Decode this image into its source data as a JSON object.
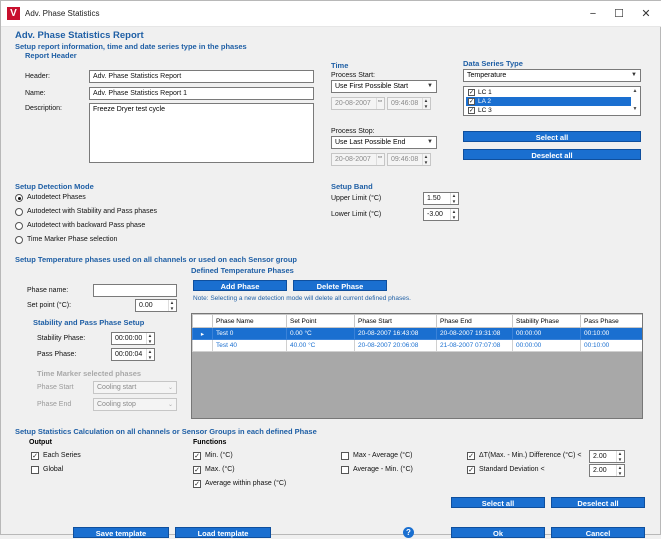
{
  "window": {
    "title": "Adv. Phase Statistics",
    "app_icon": "V",
    "min": "−",
    "max": "☐",
    "close": "✕"
  },
  "report": {
    "heading": "Adv. Phase Statistics Report",
    "subheading": "Setup report information, time and date series type in the phases",
    "section": "Report Header",
    "header_label": "Header:",
    "header_value": "Adv. Phase Statistics Report",
    "name_label": "Name:",
    "name_value": "Adv. Phase Statistics Report 1",
    "desc_label": "Description:",
    "desc_value": "Freeze Dryer test cycle"
  },
  "time": {
    "section": "Time",
    "start_label": "Process Start:",
    "start_option": "Use First Possible Start",
    "start_date": "20-08-2007",
    "start_time": "09:46:08",
    "stop_label": "Process Stop:",
    "stop_option": "Use Last Possible End",
    "stop_date": "20-08-2007",
    "stop_time": "09:46:08"
  },
  "data_series": {
    "section": "Data Series Type",
    "type": "Temperature",
    "items": [
      {
        "label": "LC 1",
        "checked": true,
        "selected": false
      },
      {
        "label": "LA 2",
        "checked": true,
        "selected": true
      },
      {
        "label": "LC 3",
        "checked": true,
        "selected": false
      }
    ],
    "select_all": "Select all",
    "deselect_all": "Deselect all"
  },
  "detection": {
    "section": "Setup Detection Mode",
    "options": [
      "Autodetect Phases",
      "Autodetect with Stability and Pass phases",
      "Autodetect with backward Pass phase",
      "Time Marker Phase selection"
    ],
    "selected": 0
  },
  "band": {
    "section": "Setup Band",
    "upper_label": "Upper Limit (°C)",
    "upper_value": "1.50",
    "lower_label": "Lower Limit (°C)",
    "lower_value": "-3.00"
  },
  "phases": {
    "section": "Setup Temperature phases used on all channels or used on each Sensor group",
    "defined_title": "Defined Temperature Phases",
    "name_label": "Phase name:",
    "name_value": "",
    "setpoint_label": "Set point (°C):",
    "setpoint_value": "0.00",
    "add": "Add Phase",
    "delete": "Delete Phase",
    "note": "Note: Selecting a new detection mode will delete all current defined phases.",
    "stab_section": "Stability and Pass Phase Setup",
    "stab_label": "Stability Phase:",
    "stab_value": "00:00:00",
    "pass_label": "Pass Phase:",
    "pass_value": "00:00:04",
    "marker_section": "Time Marker selected phases",
    "phase_start_label": "Phase Start",
    "phase_start_value": "Cooling start",
    "phase_end_label": "Phase End",
    "phase_end_value": "Cooling stop",
    "columns": [
      "Phase Name",
      "Set Point",
      "Phase Start",
      "Phase End",
      "Stability Phase",
      "Pass Phase"
    ],
    "rows": [
      {
        "marker": "▸",
        "cells": [
          "Test 0",
          "0.00 °C",
          "20-08-2007 16:43:08",
          "20-08-2007 19:31:08",
          "00:00:00",
          "00:10:00"
        ]
      },
      {
        "marker": "",
        "cells": [
          "Test 40",
          "40.00 °C",
          "20-08-2007 20:06:08",
          "21-08-2007 07:07:08",
          "00:00:00",
          "00:10:00"
        ]
      }
    ]
  },
  "stats": {
    "section": "Setup Statistics Calculation on all channels or Sensor Groups in each defined Phase",
    "output_title": "Output",
    "functions_title": "Functions",
    "output": [
      {
        "label": "Each Series",
        "checked": true
      },
      {
        "label": "Global",
        "checked": false
      }
    ],
    "func_col1": [
      {
        "label": "Min. (°C)",
        "checked": true
      },
      {
        "label": "Max. (°C)",
        "checked": true
      },
      {
        "label": "Average within phase (°C)",
        "checked": true
      }
    ],
    "func_col2": [
      {
        "label": "Max - Average (°C)",
        "checked": false
      },
      {
        "label": "Average - Min. (°C)",
        "checked": false
      }
    ],
    "func_col3": [
      {
        "label": "ΔT(Max. - Min.) Difference (°C) <",
        "checked": true,
        "value": "2.00"
      },
      {
        "label": "Standard Deviation <",
        "checked": true,
        "value": "2.00"
      }
    ],
    "select_all": "Select all",
    "deselect_all": "Deselect all"
  },
  "footer": {
    "save": "Save template",
    "load": "Load template",
    "help": "?",
    "ok": "Ok",
    "cancel": "Cancel"
  },
  "colors": {
    "accent": "#1a6fd0",
    "heading": "#1f5fa5"
  }
}
